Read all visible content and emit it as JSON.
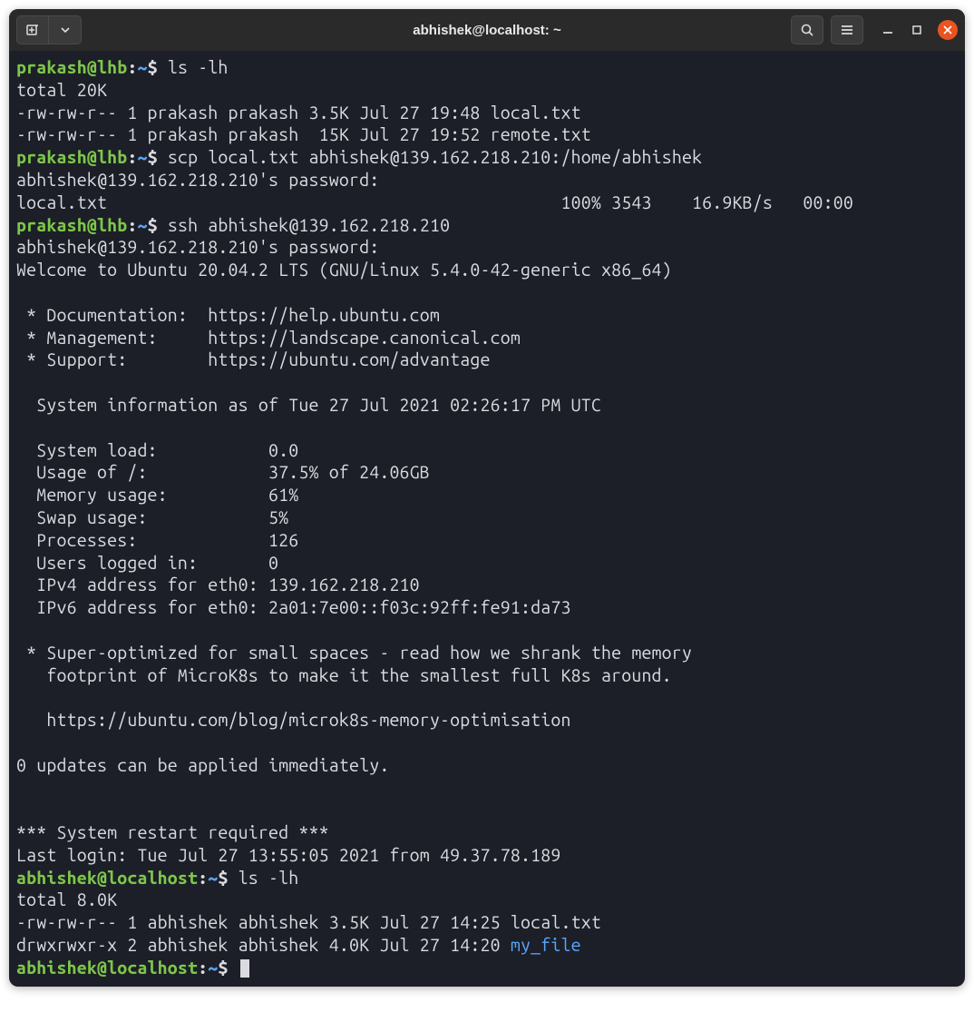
{
  "window": {
    "title": "abhishek@localhost: ~"
  },
  "prompts": {
    "p1": {
      "user": "prakash@lhb",
      "path": "~",
      "cmd": "ls -lh"
    },
    "p2": {
      "user": "prakash@lhb",
      "path": "~",
      "cmd": "scp local.txt abhishek@139.162.218.210:/home/abhishek"
    },
    "p3": {
      "user": "prakash@lhb",
      "path": "~",
      "cmd": "ssh abhishek@139.162.218.210"
    },
    "p4": {
      "user": "abhishek@localhost",
      "path": "~",
      "cmd": "ls -lh"
    },
    "p5": {
      "user": "abhishek@localhost",
      "path": "~",
      "cmd": ""
    }
  },
  "out": {
    "total1": "total 20K",
    "ls1a": "-rw-rw-r-- 1 prakash prakash 3.5K Jul 27 19:48 local.txt",
    "ls1b": "-rw-rw-r-- 1 prakash prakash  15K Jul 27 19:52 remote.txt",
    "pw1": "abhishek@139.162.218.210's password: ",
    "scp1": "local.txt                                             100% 3543    16.9KB/s   00:00    ",
    "pw2": "abhishek@139.162.218.210's password: ",
    "welcome": "Welcome to Ubuntu 20.04.2 LTS (GNU/Linux 5.4.0-42-generic x86_64)",
    "doc": " * Documentation:  https://help.ubuntu.com",
    "mgmt": " * Management:     https://landscape.canonical.com",
    "sup": " * Support:        https://ubuntu.com/advantage",
    "sysinfo": "  System information as of Tue 27 Jul 2021 02:26:17 PM UTC",
    "load": "  System load:           0.0",
    "usage": "  Usage of /:            37.5% of 24.06GB",
    "mem": "  Memory usage:          61%",
    "swap": "  Swap usage:            5%",
    "proc": "  Processes:             126",
    "users": "  Users logged in:       0",
    "ipv4": "  IPv4 address for eth0: 139.162.218.210",
    "ipv6": "  IPv6 address for eth0: 2a01:7e00::f03c:92ff:fe91:da73",
    "opt1": " * Super-optimized for small spaces - read how we shrank the memory",
    "opt2": "   footprint of MicroK8s to make it the smallest full K8s around.",
    "opt3": "   https://ubuntu.com/blog/microk8s-memory-optimisation",
    "updates": "0 updates can be applied immediately.",
    "restart": "*** System restart required ***",
    "lastlogin": "Last login: Tue Jul 27 13:55:05 2021 from 49.37.78.189",
    "total2": "total 8.0K",
    "ls2a": "-rw-rw-r-- 1 abhishek abhishek 3.5K Jul 27 14:25 local.txt",
    "ls2b_pre": "drwxrwxr-x 2 abhishek abhishek 4.0K Jul 27 14:20 ",
    "ls2b_dir": "my_file"
  }
}
